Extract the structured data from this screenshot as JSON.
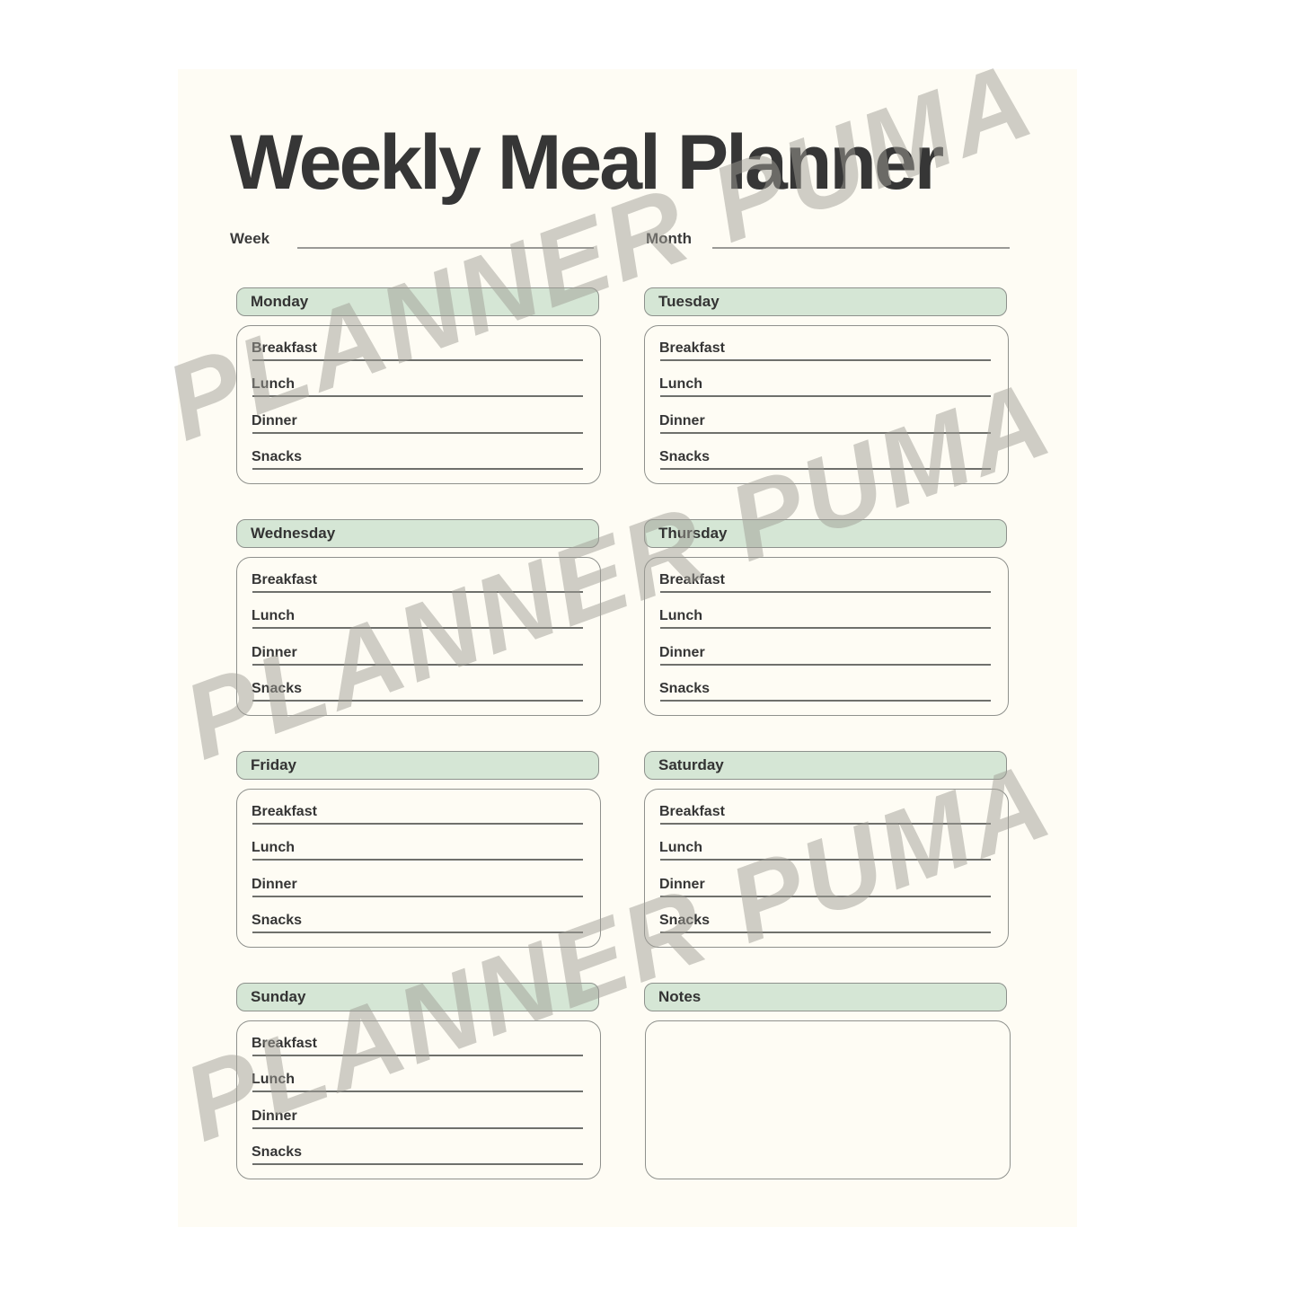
{
  "title": "Weekly Meal Planner",
  "fields": {
    "week_label": "Week",
    "week_value": "",
    "month_label": "Month",
    "month_value": ""
  },
  "meals": [
    "Breakfast",
    "Lunch",
    "Dinner",
    "Snacks"
  ],
  "days": [
    {
      "name": "Monday"
    },
    {
      "name": "Tuesday"
    },
    {
      "name": "Wednesday"
    },
    {
      "name": "Thursday"
    },
    {
      "name": "Friday"
    },
    {
      "name": "Saturday"
    },
    {
      "name": "Sunday"
    }
  ],
  "notes": {
    "label": "Notes",
    "value": ""
  },
  "watermark": "PLANNER PUMA",
  "colors": {
    "page_background": "#fefcf4",
    "header_fill": "#d5e6d5",
    "title_text": "#363636"
  }
}
